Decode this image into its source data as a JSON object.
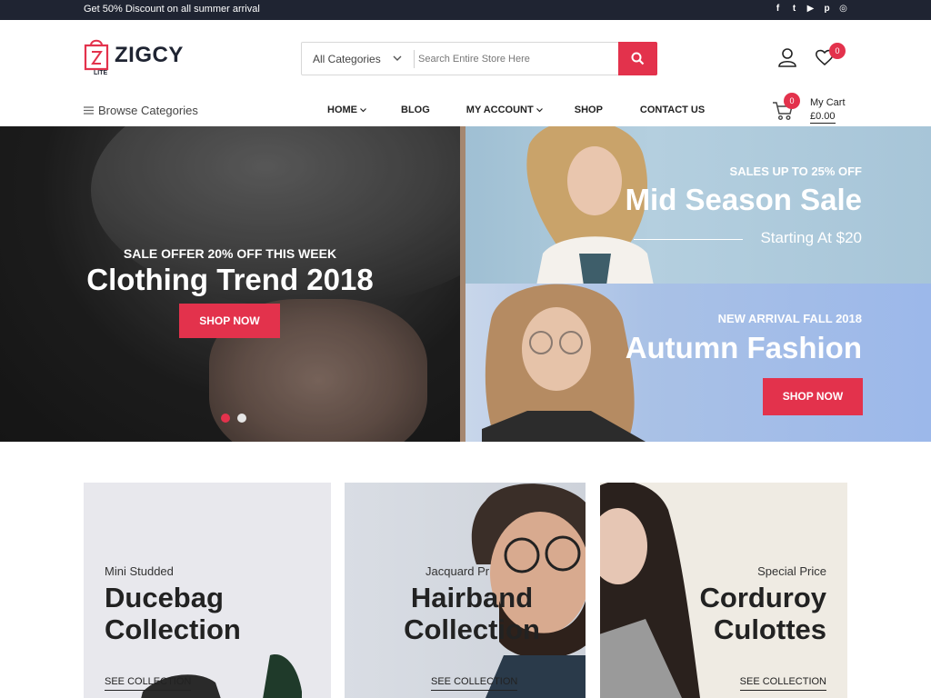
{
  "topbar": {
    "promo": "Get 50% Discount on all summer arrival",
    "social": [
      {
        "icon": "facebook-icon",
        "glyph": "f"
      },
      {
        "icon": "twitter-icon",
        "glyph": "t"
      },
      {
        "icon": "youtube-icon",
        "glyph": "▶"
      },
      {
        "icon": "pinterest-icon",
        "glyph": "p"
      },
      {
        "icon": "instagram-icon",
        "glyph": "◎"
      }
    ]
  },
  "header": {
    "logo_text": "ZIGCY",
    "logo_sub": "LITE",
    "search": {
      "category": "All Categories",
      "placeholder": "Search Entire Store Here"
    },
    "wishlist_count": "0"
  },
  "nav": {
    "browse_label": "Browse Categories",
    "items": [
      "HOME",
      "BLOG",
      "MY ACCOUNT",
      "SHOP",
      "CONTACT US"
    ],
    "cart_label": "My Cart",
    "cart_total": "£0.00",
    "cart_count": "0"
  },
  "hero": {
    "main": {
      "subtitle": "SALE OFFER 20% OFF THIS WEEK",
      "title": "Clothing Trend 2018",
      "button": "SHOP NOW"
    },
    "banner1": {
      "subtitle": "SALES UP TO 25% OFF",
      "title": "Mid Season Sale",
      "small": "Starting At $20"
    },
    "banner2": {
      "subtitle": "NEW ARRIVAL FALL 2018",
      "title": "Autumn Fashion",
      "button": "SHOP NOW"
    }
  },
  "collections": [
    {
      "kicker": "Mini Studded",
      "line1": "Ducebag",
      "line2": "Collection",
      "cta": "SEE COLLECTION"
    },
    {
      "kicker": "Jacquard Pr",
      "line1": "Hairband",
      "line2": "Collection",
      "cta": "SEE COLLECTION"
    },
    {
      "kicker": "Special Price",
      "line1": "Corduroy",
      "line2": "Culottes",
      "cta": "SEE COLLECTION"
    }
  ],
  "colors": {
    "accent": "#e3324c",
    "dark": "#1f2432"
  }
}
